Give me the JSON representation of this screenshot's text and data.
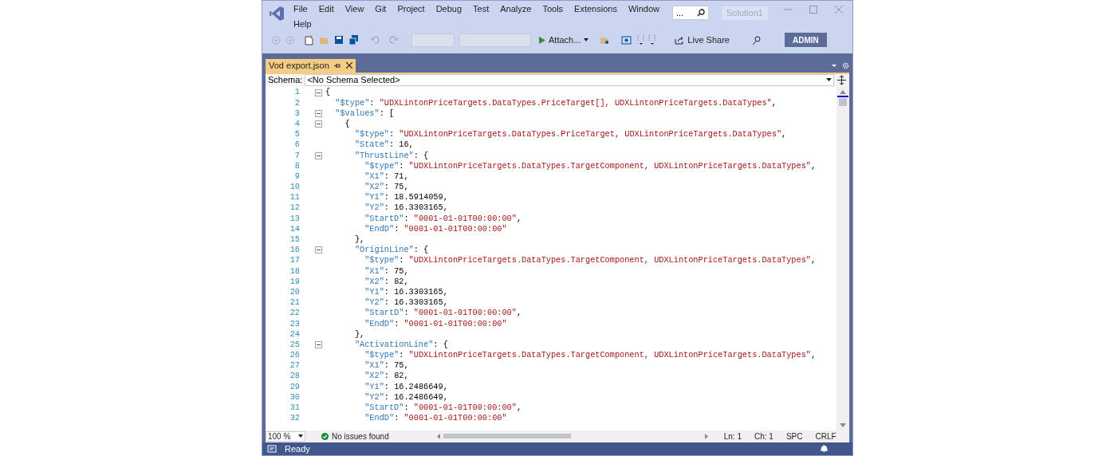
{
  "menu": [
    "File",
    "Edit",
    "View",
    "Git",
    "Project",
    "Debug",
    "Test",
    "Analyze",
    "Tools",
    "Extensions",
    "Window",
    "Help"
  ],
  "search": {
    "value": "..."
  },
  "solution": "Solution1",
  "toolbar": {
    "attach": "Attach...",
    "live_share": "Live Share",
    "account": "ADMIN"
  },
  "tab": {
    "label": "Vod export.json",
    "selected": true
  },
  "schema": {
    "label": "Schema:",
    "value": "<No Schema Selected>"
  },
  "lines": [
    {
      "number": "1",
      "expanded": true,
      "tokens": [
        {
          "kind": "punct",
          "text": "{"
        }
      ]
    },
    {
      "number": "2",
      "tokens": [
        {
          "kind": "key",
          "text": "  \"$type\""
        },
        {
          "kind": "punct",
          "text": ": "
        },
        {
          "kind": "string",
          "text": "\"UDXLintonPriceTargets.DataTypes.PriceTarget[], UDXLintonPriceTargets.DataTypes\""
        },
        {
          "kind": "punct",
          "text": ","
        }
      ]
    },
    {
      "number": "3",
      "expanded": true,
      "tokens": [
        {
          "kind": "key",
          "text": "  \"$values\""
        },
        {
          "kind": "punct",
          "text": ": ["
        }
      ]
    },
    {
      "number": "4",
      "expanded": true,
      "tokens": [
        {
          "kind": "punct",
          "text": "    {"
        }
      ]
    },
    {
      "number": "5",
      "tokens": [
        {
          "kind": "key",
          "text": "      \"$type\""
        },
        {
          "kind": "punct",
          "text": ": "
        },
        {
          "kind": "string",
          "text": "\"UDXLintonPriceTargets.DataTypes.PriceTarget, UDXLintonPriceTargets.DataTypes\""
        },
        {
          "kind": "punct",
          "text": ","
        }
      ]
    },
    {
      "number": "6",
      "tokens": [
        {
          "kind": "key",
          "text": "      \"State\""
        },
        {
          "kind": "punct",
          "text": ": "
        },
        {
          "kind": "number",
          "text": "16"
        },
        {
          "kind": "punct",
          "text": ","
        }
      ]
    },
    {
      "number": "7",
      "expanded": true,
      "tokens": [
        {
          "kind": "key",
          "text": "      \"ThrustLine\""
        },
        {
          "kind": "punct",
          "text": ": {"
        }
      ]
    },
    {
      "number": "8",
      "tokens": [
        {
          "kind": "key",
          "text": "        \"$type\""
        },
        {
          "kind": "punct",
          "text": ": "
        },
        {
          "kind": "string",
          "text": "\"UDXLintonPriceTargets.DataTypes.TargetComponent, UDXLintonPriceTargets.DataTypes\""
        },
        {
          "kind": "punct",
          "text": ","
        }
      ]
    },
    {
      "number": "9",
      "tokens": [
        {
          "kind": "key",
          "text": "        \"X1\""
        },
        {
          "kind": "punct",
          "text": ": "
        },
        {
          "kind": "number",
          "text": "71"
        },
        {
          "kind": "punct",
          "text": ","
        }
      ]
    },
    {
      "number": "10",
      "tokens": [
        {
          "kind": "key",
          "text": "        \"X2\""
        },
        {
          "kind": "punct",
          "text": ": "
        },
        {
          "kind": "number",
          "text": "75"
        },
        {
          "kind": "punct",
          "text": ","
        }
      ]
    },
    {
      "number": "11",
      "tokens": [
        {
          "kind": "key",
          "text": "        \"Y1\""
        },
        {
          "kind": "punct",
          "text": ": "
        },
        {
          "kind": "number",
          "text": "18.5914059"
        },
        {
          "kind": "punct",
          "text": ","
        }
      ]
    },
    {
      "number": "12",
      "tokens": [
        {
          "kind": "key",
          "text": "        \"Y2\""
        },
        {
          "kind": "punct",
          "text": ": "
        },
        {
          "kind": "number",
          "text": "16.3303165"
        },
        {
          "kind": "punct",
          "text": ","
        }
      ]
    },
    {
      "number": "13",
      "tokens": [
        {
          "kind": "key",
          "text": "        \"StartD\""
        },
        {
          "kind": "punct",
          "text": ": "
        },
        {
          "kind": "string",
          "text": "\"0001-01-01T00:00:00\""
        },
        {
          "kind": "punct",
          "text": ","
        }
      ]
    },
    {
      "number": "14",
      "tokens": [
        {
          "kind": "key",
          "text": "        \"EndD\""
        },
        {
          "kind": "punct",
          "text": ": "
        },
        {
          "kind": "string",
          "text": "\"0001-01-01T00:00:00\""
        }
      ]
    },
    {
      "number": "15",
      "tokens": [
        {
          "kind": "punct",
          "text": "      },"
        }
      ]
    },
    {
      "number": "16",
      "expanded": true,
      "tokens": [
        {
          "kind": "key",
          "text": "      \"OriginLine\""
        },
        {
          "kind": "punct",
          "text": ": {"
        }
      ]
    },
    {
      "number": "17",
      "tokens": [
        {
          "kind": "key",
          "text": "        \"$type\""
        },
        {
          "kind": "punct",
          "text": ": "
        },
        {
          "kind": "string",
          "text": "\"UDXLintonPriceTargets.DataTypes.TargetComponent, UDXLintonPriceTargets.DataTypes\""
        },
        {
          "kind": "punct",
          "text": ","
        }
      ]
    },
    {
      "number": "18",
      "tokens": [
        {
          "kind": "key",
          "text": "        \"X1\""
        },
        {
          "kind": "punct",
          "text": ": "
        },
        {
          "kind": "number",
          "text": "75"
        },
        {
          "kind": "punct",
          "text": ","
        }
      ]
    },
    {
      "number": "19",
      "tokens": [
        {
          "kind": "key",
          "text": "        \"X2\""
        },
        {
          "kind": "punct",
          "text": ": "
        },
        {
          "kind": "number",
          "text": "82"
        },
        {
          "kind": "punct",
          "text": ","
        }
      ]
    },
    {
      "number": "20",
      "tokens": [
        {
          "kind": "key",
          "text": "        \"Y1\""
        },
        {
          "kind": "punct",
          "text": ": "
        },
        {
          "kind": "number",
          "text": "16.3303165"
        },
        {
          "kind": "punct",
          "text": ","
        }
      ]
    },
    {
      "number": "21",
      "tokens": [
        {
          "kind": "key",
          "text": "        \"Y2\""
        },
        {
          "kind": "punct",
          "text": ": "
        },
        {
          "kind": "number",
          "text": "16.3303165"
        },
        {
          "kind": "punct",
          "text": ","
        }
      ]
    },
    {
      "number": "22",
      "tokens": [
        {
          "kind": "key",
          "text": "        \"StartD\""
        },
        {
          "kind": "punct",
          "text": ": "
        },
        {
          "kind": "string",
          "text": "\"0001-01-01T00:00:00\""
        },
        {
          "kind": "punct",
          "text": ","
        }
      ]
    },
    {
      "number": "23",
      "tokens": [
        {
          "kind": "key",
          "text": "        \"EndD\""
        },
        {
          "kind": "punct",
          "text": ": "
        },
        {
          "kind": "string",
          "text": "\"0001-01-01T00:00:00\""
        }
      ]
    },
    {
      "number": "24",
      "tokens": [
        {
          "kind": "punct",
          "text": "      },"
        }
      ]
    },
    {
      "number": "25",
      "expanded": true,
      "tokens": [
        {
          "kind": "key",
          "text": "      \"ActivationLine\""
        },
        {
          "kind": "punct",
          "text": ": {"
        }
      ]
    },
    {
      "number": "26",
      "tokens": [
        {
          "kind": "key",
          "text": "        \"$type\""
        },
        {
          "kind": "punct",
          "text": ": "
        },
        {
          "kind": "string",
          "text": "\"UDXLintonPriceTargets.DataTypes.TargetComponent, UDXLintonPriceTargets.DataTypes\""
        },
        {
          "kind": "punct",
          "text": ","
        }
      ]
    },
    {
      "number": "27",
      "tokens": [
        {
          "kind": "key",
          "text": "        \"X1\""
        },
        {
          "kind": "punct",
          "text": ": "
        },
        {
          "kind": "number",
          "text": "75"
        },
        {
          "kind": "punct",
          "text": ","
        }
      ]
    },
    {
      "number": "28",
      "tokens": [
        {
          "kind": "key",
          "text": "        \"X2\""
        },
        {
          "kind": "punct",
          "text": ": "
        },
        {
          "kind": "number",
          "text": "82"
        },
        {
          "kind": "punct",
          "text": ","
        }
      ]
    },
    {
      "number": "29",
      "tokens": [
        {
          "kind": "key",
          "text": "        \"Y1\""
        },
        {
          "kind": "punct",
          "text": ": "
        },
        {
          "kind": "number",
          "text": "16.2486649"
        },
        {
          "kind": "punct",
          "text": ","
        }
      ]
    },
    {
      "number": "30",
      "tokens": [
        {
          "kind": "key",
          "text": "        \"Y2\""
        },
        {
          "kind": "punct",
          "text": ": "
        },
        {
          "kind": "number",
          "text": "16.2486649"
        },
        {
          "kind": "punct",
          "text": ","
        }
      ]
    },
    {
      "number": "31",
      "tokens": [
        {
          "kind": "key",
          "text": "        \"StartD\""
        },
        {
          "kind": "punct",
          "text": ": "
        },
        {
          "kind": "string",
          "text": "\"0001-01-01T00:00:00\""
        },
        {
          "kind": "punct",
          "text": ","
        }
      ]
    },
    {
      "number": "32",
      "tokens": [
        {
          "kind": "key",
          "text": "        \"EndD\""
        },
        {
          "kind": "punct",
          "text": ": "
        },
        {
          "kind": "string",
          "text": "\"0001-01-01T00:00:00\""
        }
      ]
    }
  ],
  "editor_status": {
    "zoom": "100 %",
    "issues": "No issues found",
    "line": "Ln: 1",
    "char": "Ch: 1",
    "indent": "SPC",
    "line_endings": "CRLF"
  },
  "status_bar": "Ready"
}
